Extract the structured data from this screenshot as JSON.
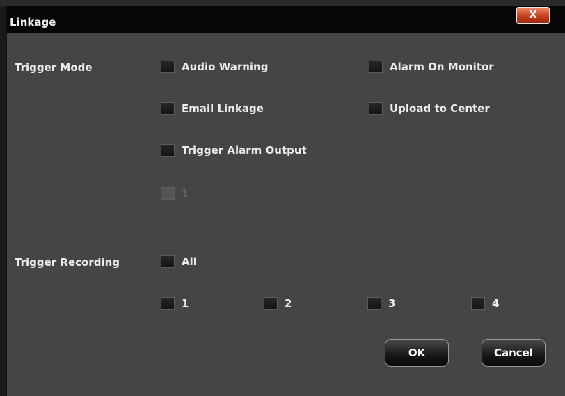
{
  "dialog": {
    "title": "Linkage",
    "close_label": "X"
  },
  "trigger_mode": {
    "label": "Trigger Mode",
    "options": [
      {
        "label": "Audio Warning",
        "checked": false
      },
      {
        "label": "Alarm On Monitor",
        "checked": false
      },
      {
        "label": "Email Linkage",
        "checked": false
      },
      {
        "label": "Upload to Center",
        "checked": false
      },
      {
        "label": "Trigger Alarm Output",
        "checked": false
      }
    ],
    "alarm_outputs": [
      {
        "label": "1",
        "checked": false,
        "enabled": false
      }
    ]
  },
  "trigger_recording": {
    "label": "Trigger Recording",
    "all_label": "All",
    "channels": [
      {
        "label": "1",
        "checked": false
      },
      {
        "label": "2",
        "checked": false
      },
      {
        "label": "3",
        "checked": false
      },
      {
        "label": "4",
        "checked": false
      }
    ]
  },
  "buttons": {
    "ok": "OK",
    "cancel": "Cancel"
  }
}
